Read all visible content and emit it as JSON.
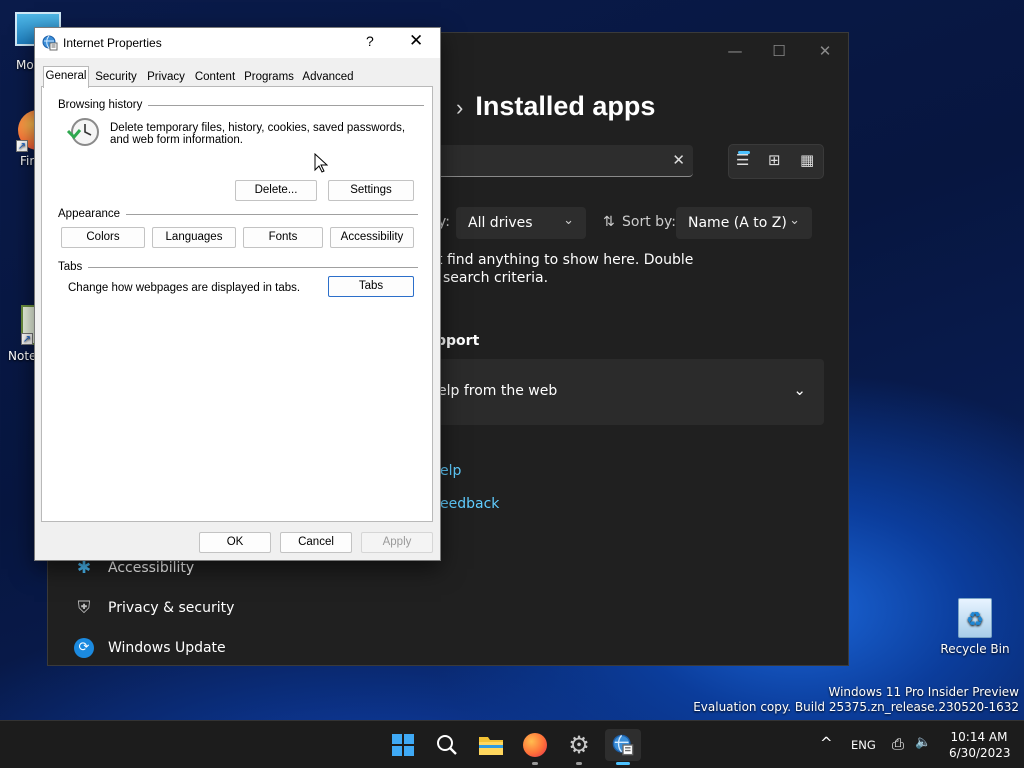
{
  "desktop": {
    "icons": [
      {
        "label": "Mo",
        "name": "desktop-icon-monitor"
      },
      {
        "label": "Fir",
        "name": "desktop-icon-firefox"
      },
      {
        "label": "Note",
        "name": "desktop-icon-notepad"
      },
      {
        "label": "Recycle Bin",
        "name": "desktop-icon-recycle-bin"
      }
    ],
    "watermark": {
      "line1": "Windows 11 Pro Insider Preview",
      "line2": "Evaluation copy. Build 25375.zn_release.230520-1632"
    }
  },
  "settings": {
    "window_buttons": {
      "minimize": "—",
      "maximize": "☐",
      "close": "✕"
    },
    "breadcrumb_chevron": "›",
    "heading": "Installed apps",
    "search": {
      "value": "",
      "clear_glyph": "✕"
    },
    "view_switch": {
      "list": "☰",
      "tiles": "⊞",
      "grid": "▦"
    },
    "filter_label_fragment": "y:",
    "filter_value": "All drives",
    "sort_label": "Sort by:",
    "sort_icon": "⇅",
    "sort_value": "Name (A to Z)",
    "dropdown_caret": "⌄",
    "empty_message_line1": "t find anything to show here. Double",
    "empty_message_line2": "search criteria.",
    "support_section": "pport",
    "support_card": "elp from the web",
    "links": {
      "help": "elp",
      "feedback": "eedback"
    },
    "nav": [
      {
        "label": "Accessibility",
        "icon": "accessibility-icon"
      },
      {
        "label": "Privacy & security",
        "icon": "shield-icon"
      },
      {
        "label": "Windows Update",
        "icon": "update-icon"
      }
    ]
  },
  "dialog": {
    "title": "Internet Properties",
    "help_glyph": "?",
    "close_glyph": "✕",
    "tabs": [
      "General",
      "Security",
      "Privacy",
      "Content",
      "Programs",
      "Advanced"
    ],
    "selected_tab": "General",
    "browsing_history": {
      "label": "Browsing history",
      "description_line1": "Delete temporary files, history, cookies, saved passwords,",
      "description_line2": "and web form information.",
      "delete_button": "Delete...",
      "settings_button": "Settings"
    },
    "appearance": {
      "label": "Appearance",
      "buttons": [
        "Colors",
        "Languages",
        "Fonts",
        "Accessibility"
      ]
    },
    "tabs_group": {
      "label": "Tabs",
      "description": "Change how webpages are displayed in tabs.",
      "button": "Tabs"
    },
    "footer": {
      "ok": "OK",
      "cancel": "Cancel",
      "apply": "Apply"
    }
  },
  "taskbar": {
    "apps": [
      {
        "name": "start-icon",
        "glyph": "⊞"
      },
      {
        "name": "search-icon",
        "glyph": "⌕"
      },
      {
        "name": "file-explorer-icon",
        "glyph": "▬"
      },
      {
        "name": "firefox-icon",
        "glyph": "●"
      },
      {
        "name": "settings-icon",
        "glyph": "⚙"
      },
      {
        "name": "internet-properties-icon",
        "glyph": "◉"
      }
    ],
    "tray": {
      "overflow_glyph": "^",
      "language": "ENG",
      "network_glyph": "⎙",
      "volume_glyph": "🔈",
      "time": "10:14 AM",
      "date": "6/30/2023"
    }
  },
  "colors": {
    "accent": "#0067c0",
    "link": "#60cdff",
    "settings_bg": "#202020"
  }
}
